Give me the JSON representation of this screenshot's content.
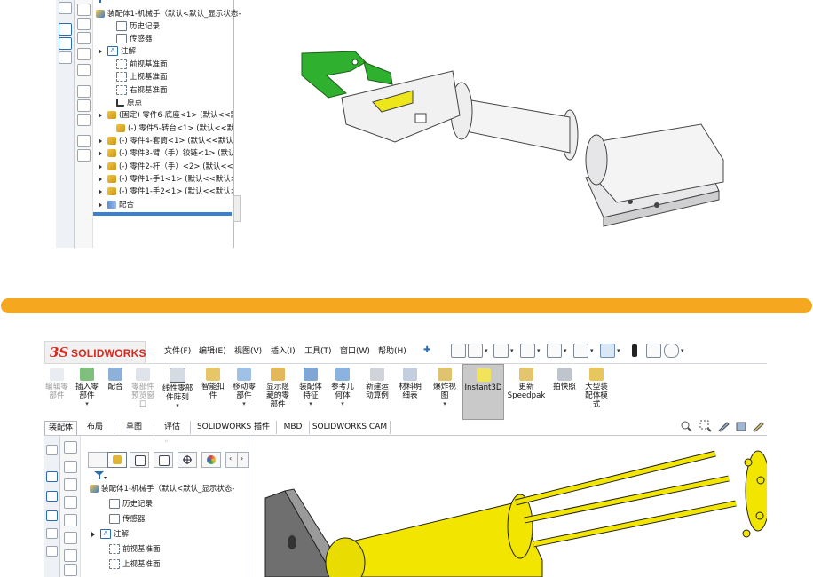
{
  "top_screenshot": {
    "tree": {
      "root": "装配体1-机械手（默认<默认_显示状态-",
      "items": [
        {
          "label": "历史记录",
          "icon": "history-icon"
        },
        {
          "label": "传感器",
          "icon": "sensor-icon"
        },
        {
          "label": "注解",
          "icon": "annotation-icon"
        },
        {
          "label": "前视基准面",
          "icon": "plane-icon"
        },
        {
          "label": "上视基准面",
          "icon": "plane-icon"
        },
        {
          "label": "右视基准面",
          "icon": "plane-icon"
        },
        {
          "label": "原点",
          "icon": "origin-icon"
        },
        {
          "label": "(固定) 零件6-底座<1> (默认<<默认",
          "icon": "part-icon"
        },
        {
          "label": "(-) 零件5-转台<1> (默认<<默认>_",
          "icon": "part-icon"
        },
        {
          "label": "(-) 零件4-套筒<1> (默认<<默认>_",
          "icon": "part-icon"
        },
        {
          "label": "(-) 零件3-臂（手）铰链<1> (默认<",
          "icon": "part-icon"
        },
        {
          "label": "(-) 零件2-杆（手）<2> (默认<<默",
          "icon": "part-icon"
        },
        {
          "label": "(-) 零件1-手1<1> (默认<<默认>_显",
          "icon": "part-icon"
        },
        {
          "label": "(-) 零件1-手2<1> (默认<<默认>_显",
          "icon": "part-icon"
        },
        {
          "label": "配合",
          "icon": "mate-icon"
        }
      ]
    }
  },
  "bottom_screenshot": {
    "logo": {
      "ds": "3S",
      "text": "SOLIDWORKS"
    },
    "menu": [
      "文件(F)",
      "编辑(E)",
      "视图(V)",
      "插入(I)",
      "工具(T)",
      "窗口(W)",
      "帮助(H)"
    ],
    "ribbon": [
      {
        "label": "编辑零\n部件",
        "disabled": true,
        "dropdown": false,
        "icon": "edit-component-icon"
      },
      {
        "label": "插入零\n部件",
        "disabled": false,
        "dropdown": true,
        "icon": "insert-component-icon"
      },
      {
        "label": "配合",
        "disabled": false,
        "dropdown": false,
        "icon": "mate-icon"
      },
      {
        "label": "零部件\n预览窗\n口",
        "disabled": true,
        "dropdown": false,
        "icon": "preview-window-icon"
      },
      {
        "label": "线性零部\n件阵列",
        "disabled": false,
        "dropdown": true,
        "icon": "linear-pattern-icon"
      },
      {
        "label": "智能扣\n件",
        "disabled": false,
        "dropdown": false,
        "icon": "smart-fastener-icon"
      },
      {
        "label": "移动零\n部件",
        "disabled": false,
        "dropdown": true,
        "icon": "move-component-icon"
      },
      {
        "label": "显示隐\n藏的零\n部件",
        "disabled": false,
        "dropdown": false,
        "icon": "show-hidden-icon"
      },
      {
        "label": "装配体\n特征",
        "disabled": false,
        "dropdown": true,
        "icon": "assembly-feature-icon"
      },
      {
        "label": "参考几\n何体",
        "disabled": false,
        "dropdown": true,
        "icon": "reference-geometry-icon"
      },
      {
        "label": "新建运\n动算例",
        "disabled": false,
        "dropdown": false,
        "icon": "motion-study-icon"
      },
      {
        "label": "材料明\n细表",
        "disabled": false,
        "dropdown": false,
        "icon": "bom-icon"
      },
      {
        "label": "爆炸视\n图",
        "disabled": false,
        "dropdown": true,
        "icon": "exploded-view-icon"
      },
      {
        "label": "Instant3D",
        "disabled": false,
        "dropdown": false,
        "active": true,
        "icon": "instant3d-icon"
      },
      {
        "label": "更新\nSpeedpak",
        "disabled": false,
        "dropdown": false,
        "icon": "speedpak-icon"
      },
      {
        "label": "拍快照",
        "disabled": false,
        "dropdown": false,
        "icon": "snapshot-icon"
      },
      {
        "label": "大型装\n配体模\n式",
        "disabled": false,
        "dropdown": false,
        "icon": "large-assembly-icon"
      }
    ],
    "tabs": [
      "装配体",
      "布局",
      "草图",
      "评估",
      "SOLIDWORKS 插件",
      "MBD",
      "SOLIDWORKS CAM"
    ],
    "tree": {
      "root": "装配体1-机械手（默认<默认_显示状态-",
      "items": [
        {
          "label": "历史记录",
          "icon": "history-icon"
        },
        {
          "label": "传感器",
          "icon": "sensor-icon"
        },
        {
          "label": "注解",
          "icon": "annotation-icon"
        },
        {
          "label": "前视基准面",
          "icon": "plane-icon"
        },
        {
          "label": "上视基准面",
          "icon": "plane-icon"
        }
      ]
    },
    "colors": {
      "accent_bar": "#f5a81f",
      "logo_red": "#d52b1e",
      "model_yellow": "#f2e600",
      "gripper_green": "#2fb02f"
    }
  }
}
